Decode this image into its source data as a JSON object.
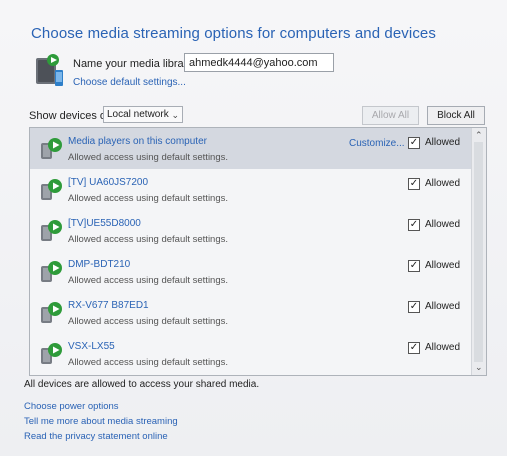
{
  "header": {
    "title": "Choose media streaming options for computers and devices"
  },
  "library": {
    "name_label": "Name your media library:",
    "name_value": "ahmedk4444@yahoo.com",
    "default_link": "Choose default settings..."
  },
  "filter": {
    "show_label": "Show devices on:",
    "selected": "Local network",
    "allow_all": "Allow All",
    "block_all": "Block All"
  },
  "devices": [
    {
      "name": "Media players on this computer",
      "desc": "Allowed access using default settings.",
      "customize": "Customize...",
      "status": "Allowed",
      "checked": true
    },
    {
      "name": "[TV] UA60JS7200",
      "desc": "Allowed access using default settings.",
      "status": "Allowed",
      "checked": true
    },
    {
      "name": "[TV]UE55D8000",
      "desc": "Allowed access using default settings.",
      "status": "Allowed",
      "checked": true
    },
    {
      "name": "DMP-BDT210",
      "desc": "Allowed access using default settings.",
      "status": "Allowed",
      "checked": true
    },
    {
      "name": "RX-V677 B87ED1",
      "desc": "Allowed access using default settings.",
      "status": "Allowed",
      "checked": true
    },
    {
      "name": "VSX-LX55",
      "desc": "Allowed access using default settings.",
      "status": "Allowed",
      "checked": true
    }
  ],
  "footer": {
    "status_text": "All devices are allowed to access your shared media.",
    "links": [
      "Choose power options",
      "Tell me more about media streaming",
      "Read the privacy statement online"
    ]
  },
  "colors": {
    "link": "#2a63b5",
    "selected_row": "#d4d8e0",
    "play_green": "#2e9b3a"
  },
  "icons": {
    "library": "media-library-icon",
    "device": "media-device-icon",
    "checkbox": "checkmark-icon"
  }
}
